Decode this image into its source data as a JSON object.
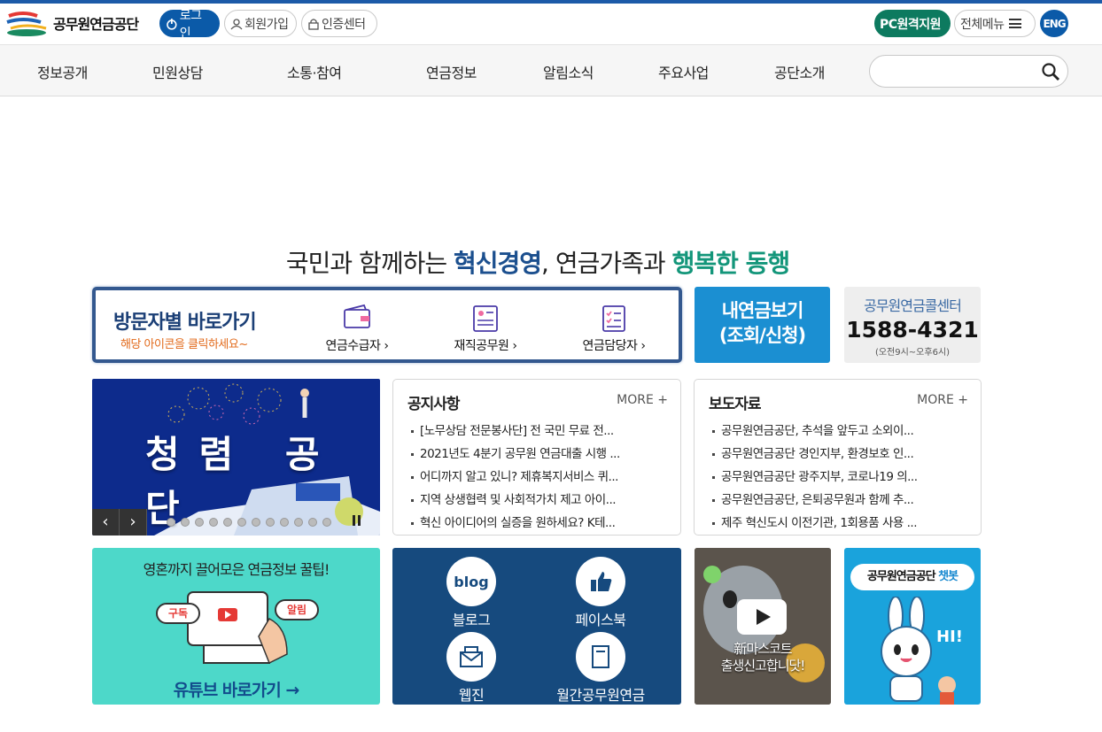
{
  "header": {
    "logo_text": "공무원연금공단",
    "login": "로그인",
    "join": "회원가입",
    "cert": "인증센터",
    "pc_support": "PC원격지원",
    "all_menu": "전체메뉴",
    "eng": "ENG"
  },
  "nav": {
    "items": [
      "정보공개",
      "민원상담",
      "소통·참여",
      "연금정보",
      "알림소식",
      "주요사업",
      "공단소개"
    ],
    "search_placeholder": ""
  },
  "headline": {
    "part1": "국민과 함께하는 ",
    "em1": "혁신경영",
    "part2": ", 연금가족과 ",
    "em2": "행복한 동행"
  },
  "visitor": {
    "title": "방문자별 바로가기",
    "subtitle": "해당 아이콘을 클릭하세요~",
    "links": [
      "연금수급자 ›",
      "재직공무원 ›",
      "연금담당자 ›"
    ]
  },
  "my_pension": {
    "line1": "내연금보기",
    "line2": "(조회/신청)"
  },
  "call_center": {
    "title": "공무원연금콜센터",
    "number": "1588-4321",
    "hours": "(오전9시~오후6시)"
  },
  "banner": {
    "text": "청렴 공단",
    "prev": "‹",
    "next": "›"
  },
  "notice": {
    "title": "공지사항",
    "more": "MORE +",
    "items": [
      "[노무상담 전문봉사단] 전 국민 무료 전...",
      "2021년도 4분기 공무원 연금대출 시행 ...",
      "어디까지 알고 있니? 제휴복지서비스 퀴...",
      "지역 상생협력 및 사회적가치 제고 아이...",
      "혁신 아이디어의 실증을 원하세요? K테..."
    ]
  },
  "press": {
    "title": "보도자료",
    "more": "MORE +",
    "items": [
      "공무원연금공단, 추석을 앞두고 소외이...",
      "공무원연금공단 경인지부, 환경보호 인...",
      "공무원연금공단 광주지부, 코로나19 의...",
      "공무원연금공단, 은퇴공무원과 함께 추...",
      "제주 혁신도시 이전기관, 1회용품 사용 ..."
    ]
  },
  "youtube": {
    "top": "영혼까지 끌어모은 연금정보 꿀팁!",
    "bottom": "유튜브 바로가기 →",
    "tag1": "구독",
    "tag2": "알림"
  },
  "sns": {
    "blog": "블로그",
    "blog_icon_text": "blog",
    "facebook": "페이스북",
    "webzine": "웹진",
    "monthly": "월간공무원연금"
  },
  "mascot": {
    "line1": "新마스코트",
    "line2": "출생신고합니닷!"
  },
  "chatbot": {
    "title": "공무원연금공단 ",
    "title_em": "챗봇",
    "hi": "HI!"
  },
  "colors": {
    "brand_blue": "#0b5aa8",
    "green": "#0d7a5f",
    "accent_teal": "#13967a",
    "navy": "#1b4f8e"
  }
}
